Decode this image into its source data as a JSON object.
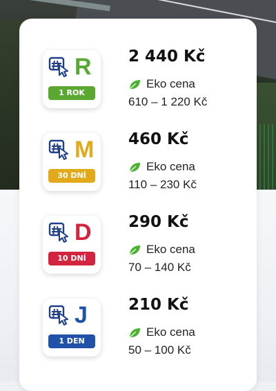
{
  "vignettes": [
    {
      "letter": "R",
      "duration": "1 ROK",
      "price": "2 440 Kč",
      "eco_label": "Eko cena",
      "eco_range": "610 – 1 220 Kč",
      "color": "#5aa832",
      "icon": "highway-cursor-icon"
    },
    {
      "letter": "M",
      "duration": "30 DNÍ",
      "price": "460 Kč",
      "eco_label": "Eko cena",
      "eco_range": "110 – 230 Kč",
      "color": "#e2a91b",
      "icon": "highway-cursor-icon"
    },
    {
      "letter": "D",
      "duration": "10 DNÍ",
      "price": "290 Kč",
      "eco_label": "Eko cena",
      "eco_range": "70 – 140 Kč",
      "color": "#d3243f",
      "icon": "highway-cursor-icon"
    },
    {
      "letter": "J",
      "duration": "1 DEN",
      "price": "210 Kč",
      "eco_label": "Eko cena",
      "eco_range": "50 – 100 Kč",
      "color": "#1f52a8",
      "icon": "highway-cursor-icon"
    }
  ],
  "colors": {
    "icon_blue": "#1f3f8a",
    "leaf_green": "#49b22e",
    "text": "#111111"
  }
}
